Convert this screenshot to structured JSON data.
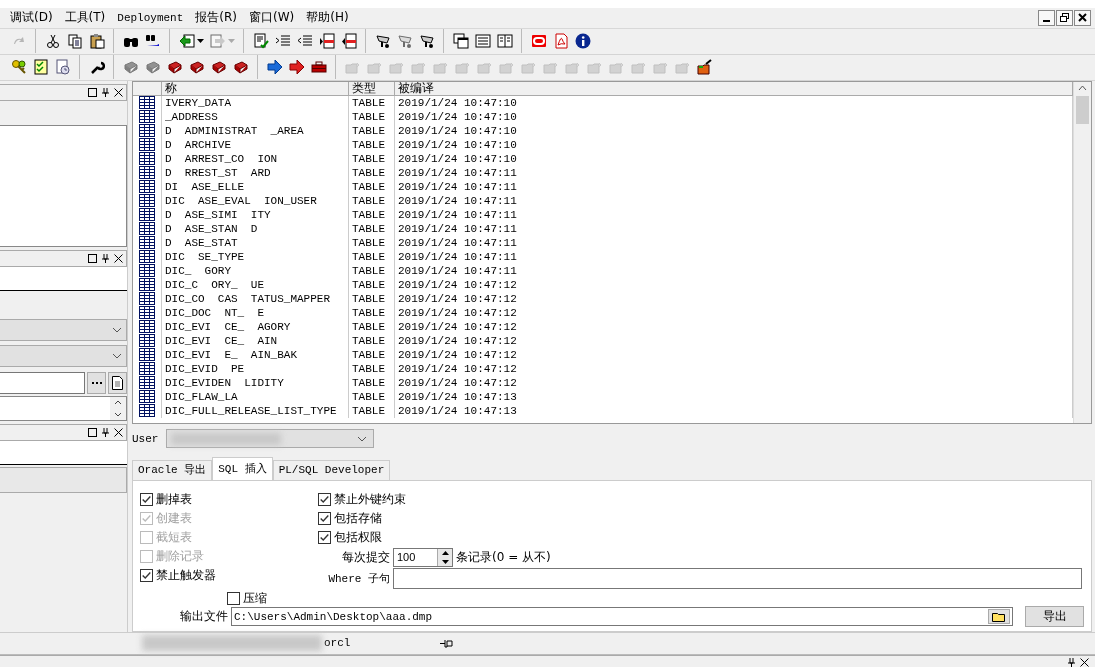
{
  "menu": [
    {
      "label": "调试(D)"
    },
    {
      "label": "工具(T)"
    },
    {
      "label": "Deployment"
    },
    {
      "label": "报告(R)"
    },
    {
      "label": "窗口(W)"
    },
    {
      "label": "帮助(H)"
    }
  ],
  "toolbars": [
    {
      "groups": [
        [
          {
            "disabled": true
          }
        ],
        [
          {
            "disabled": false
          },
          {
            "disabled": false
          },
          {
            "disabled": false
          }
        ],
        [
          {
            "disabled": false
          },
          {
            "disabled": false
          }
        ],
        [
          {
            "disabled": false,
            "dropdown": true
          },
          {
            "disabled": true,
            "dropdown": true
          }
        ],
        [
          {
            "disabled": false
          },
          {
            "disabled": false
          },
          {
            "disabled": false
          },
          {
            "disabled": false
          },
          {
            "disabled": false
          }
        ],
        [
          {
            "disabled": false
          },
          {
            "disabled": true
          },
          {
            "disabled": false
          }
        ],
        [
          {
            "disabled": false
          },
          {
            "disabled": false
          },
          {
            "disabled": false
          }
        ],
        [
          {
            "disabled": false
          },
          {
            "disabled": false
          },
          {
            "disabled": false
          }
        ]
      ]
    },
    {
      "groups": [
        [
          {
            "disabled": false
          },
          {
            "disabled": false
          },
          {
            "disabled": false
          }
        ],
        [
          {
            "disabled": false
          }
        ],
        [
          {
            "disabled": true
          },
          {
            "disabled": true
          },
          {
            "disabled": false
          },
          {
            "disabled": false
          },
          {
            "disabled": false
          },
          {
            "disabled": false
          }
        ],
        [
          {
            "disabled": false
          },
          {
            "disabled": false
          },
          {
            "disabled": false
          }
        ],
        [
          {
            "disabled": true
          },
          {
            "disabled": true
          },
          {
            "disabled": true
          },
          {
            "disabled": true
          },
          {
            "disabled": true
          },
          {
            "disabled": true
          },
          {
            "disabled": true
          },
          {
            "disabled": true
          },
          {
            "disabled": true
          },
          {
            "disabled": true
          },
          {
            "disabled": true
          },
          {
            "disabled": true
          },
          {
            "disabled": true
          },
          {
            "disabled": true
          },
          {
            "disabled": true
          },
          {
            "disabled": true
          },
          {
            "disabled": false
          }
        ]
      ]
    }
  ],
  "table": {
    "columns": [
      "称",
      "类型",
      "被编译"
    ],
    "rows": [
      {
        "name": "IVERY_DATA",
        "type": "TABLE",
        "compiled": "2019/1/24 10:47:10"
      },
      {
        "name": "_ADDRESS",
        "type": "TABLE",
        "compiled": "2019/1/24 10:47:10"
      },
      {
        "name": "D  ADMINISTRAT  _AREA",
        "type": "TABLE",
        "compiled": "2019/1/24 10:47:10"
      },
      {
        "name": "D  ARCHIVE",
        "type": "TABLE",
        "compiled": "2019/1/24 10:47:10"
      },
      {
        "name": "D  ARREST_CO  ION",
        "type": "TABLE",
        "compiled": "2019/1/24 10:47:10"
      },
      {
        "name": "D  RREST_ST  ARD",
        "type": "TABLE",
        "compiled": "2019/1/24 10:47:11"
      },
      {
        "name": "DI  ASE_ELLE",
        "type": "TABLE",
        "compiled": "2019/1/24 10:47:11"
      },
      {
        "name": "DIC  ASE_EVAL  ION_USER",
        "type": "TABLE",
        "compiled": "2019/1/24 10:47:11"
      },
      {
        "name": "D  ASE_SIMI  ITY",
        "type": "TABLE",
        "compiled": "2019/1/24 10:47:11"
      },
      {
        "name": "D  ASE_STAN  D",
        "type": "TABLE",
        "compiled": "2019/1/24 10:47:11"
      },
      {
        "name": "D  ASE_STAT",
        "type": "TABLE",
        "compiled": "2019/1/24 10:47:11"
      },
      {
        "name": "DIC  SE_TYPE",
        "type": "TABLE",
        "compiled": "2019/1/24 10:47:11"
      },
      {
        "name": "DIC_  GORY",
        "type": "TABLE",
        "compiled": "2019/1/24 10:47:11"
      },
      {
        "name": "DIC_C  ORY_  UE",
        "type": "TABLE",
        "compiled": "2019/1/24 10:47:12"
      },
      {
        "name": "DIC_CO  CAS  TATUS_MAPPER",
        "type": "TABLE",
        "compiled": "2019/1/24 10:47:12"
      },
      {
        "name": "DIC_DOC  NT_  E",
        "type": "TABLE",
        "compiled": "2019/1/24 10:47:12"
      },
      {
        "name": "DIC_EVI  CE_  AGORY",
        "type": "TABLE",
        "compiled": "2019/1/24 10:47:12"
      },
      {
        "name": "DIC_EVI  CE_  AIN",
        "type": "TABLE",
        "compiled": "2019/1/24 10:47:12"
      },
      {
        "name": "DIC_EVI  E_  AIN_BAK",
        "type": "TABLE",
        "compiled": "2019/1/24 10:47:12"
      },
      {
        "name": "DIC_EVID  PE",
        "type": "TABLE",
        "compiled": "2019/1/24 10:47:12"
      },
      {
        "name": "DIC_EVIDEN  LIDITY",
        "type": "TABLE",
        "compiled": "2019/1/24 10:47:12"
      },
      {
        "name": "DIC_FLAW_LA",
        "type": "TABLE",
        "compiled": "2019/1/24 10:47:13"
      },
      {
        "name": "DIC_FULL_RELEASE_LIST_TYPE",
        "type": "TABLE",
        "compiled": "2019/1/24 10:47:13"
      }
    ]
  },
  "user": {
    "label": "User"
  },
  "tabs": [
    {
      "label": "Oracle 导出",
      "selected": false
    },
    {
      "label": "SQL 插入",
      "selected": true
    },
    {
      "label": "PL/SQL Developer",
      "selected": false
    }
  ],
  "options_left": [
    {
      "label": "删掉表",
      "checked": true,
      "disabled": false
    },
    {
      "label": "创建表",
      "checked": true,
      "disabled": true
    },
    {
      "label": "截短表",
      "checked": false,
      "disabled": true
    },
    {
      "label": "删除记录",
      "checked": false,
      "disabled": true
    },
    {
      "label": "禁止触发器",
      "checked": true,
      "disabled": false
    }
  ],
  "options_right": [
    {
      "label": "禁止外键约束",
      "checked": true,
      "disabled": false
    },
    {
      "label": "包括存储",
      "checked": true,
      "disabled": false
    },
    {
      "label": "包括权限",
      "checked": true,
      "disabled": false
    }
  ],
  "commit": {
    "label": "每次提交",
    "value": "100",
    "suffix": "条记录(0 = 从不)"
  },
  "where": {
    "label": "Where 子句"
  },
  "compress": {
    "label": "压缩",
    "checked": false
  },
  "output": {
    "label": "输出文件",
    "value": "C:\\Users\\Admin\\Desktop\\aaa.dmp"
  },
  "export_button": "导出",
  "status_bar": {
    "connection": "orcl"
  }
}
